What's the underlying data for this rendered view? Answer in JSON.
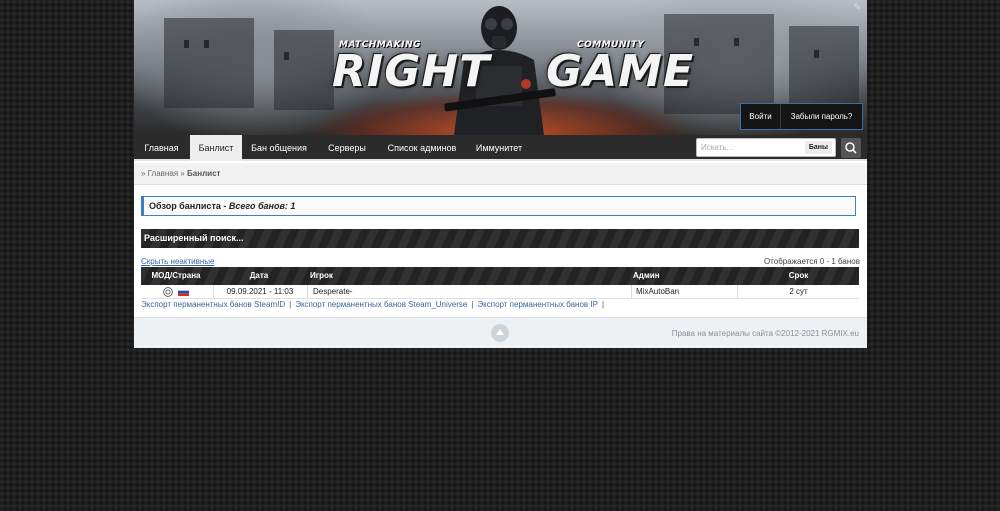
{
  "banner": {
    "logo_left_small": "MATCHMAKING",
    "logo_left_big": "RIGHT",
    "logo_right_small": "COMMUNITY",
    "logo_right_big": "GAME"
  },
  "auth": {
    "login_label": "Войти",
    "forgot_label": "Забыли пароль?"
  },
  "nav": {
    "items": [
      {
        "label": "Главная"
      },
      {
        "label": "Банлист"
      },
      {
        "label": "Бан общения"
      },
      {
        "label": "Серверы"
      },
      {
        "label": "Список админов"
      },
      {
        "label": "Иммунитет"
      }
    ],
    "active_index": 1
  },
  "search": {
    "placeholder": "Искать...",
    "scope_label": "Баны"
  },
  "breadcrumb": {
    "home": "» Главная",
    "separator": "»",
    "current": "Банлист"
  },
  "overview": {
    "title": "Обзор банлиста - ",
    "total": "Всего банов: 1"
  },
  "advanced_search_label": "Расширенный поиск...",
  "list_controls": {
    "hide_inactive": "Скрыть неактивные",
    "showing": "Отображается  0 - 1 банов"
  },
  "ban_table": {
    "headers": [
      "МОД/Страна",
      "Дата",
      "Игрок",
      "Админ",
      "Срок"
    ],
    "rows": [
      {
        "mod_icon": "game-mod-icon",
        "country": "ru",
        "date": "09.09.2021 - 11:03",
        "player": "Desperate-",
        "admin": "MixAutoBan",
        "term": "2 сут"
      }
    ]
  },
  "exports": {
    "steamid": "Экспорт перманентных банов SteamID",
    "steam_universe": "Экспорт перманентных банов Steam_Universe",
    "ip": "Экспорт перманентных банов IP",
    "separator": "|"
  },
  "footer": {
    "copyright": "Права на материалы сайта ©2012-2021 RGMIX.eu"
  },
  "colors": {
    "accent": "#3d80c6",
    "nav_bg": "#2b2b2b",
    "page_bg": "#1e1e1e"
  }
}
